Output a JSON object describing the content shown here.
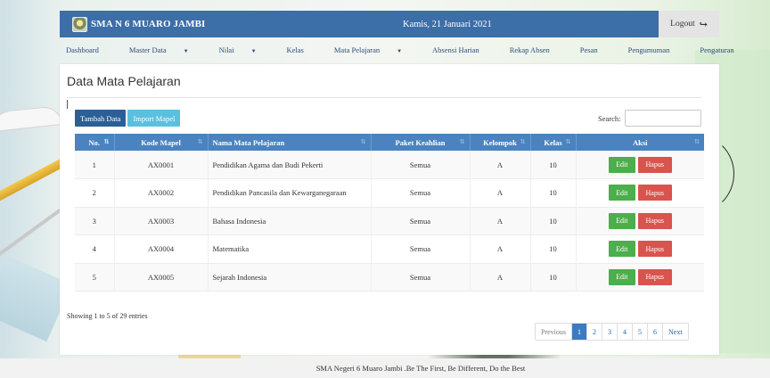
{
  "app": {
    "brand": "SMA N 6 MUARO JAMBI",
    "date": "Kamis, 21 Januari 2021",
    "logout_label": "Logout"
  },
  "menu": [
    {
      "label": "Dashboard",
      "has_caret": false
    },
    {
      "label": "Master Data",
      "has_caret": true
    },
    {
      "label": "Nilai",
      "has_caret": true
    },
    {
      "label": "Kelas",
      "has_caret": false
    },
    {
      "label": "Mata Pelajaran",
      "has_caret": true
    },
    {
      "label": "Absensi Harian",
      "has_caret": false
    },
    {
      "label": "Rekap Absen",
      "has_caret": false
    },
    {
      "label": "Pesan",
      "has_caret": false
    },
    {
      "label": "Pengumuman",
      "has_caret": false
    },
    {
      "label": "Pengaturan",
      "has_caret": false
    }
  ],
  "page": {
    "title": "Data Mata Pelajaran",
    "add_button": "Tambah Data",
    "import_button": "Import Mapel",
    "search_label": "Search:",
    "search_value": ""
  },
  "table": {
    "columns": [
      "No.",
      "Kode Mapel",
      "Nama Mata Pelajaran",
      "Paket Keahlian",
      "Kelompok",
      "Kelas",
      "Aksi"
    ],
    "rows": [
      {
        "no": "1",
        "kode": "AX0001",
        "nama": "Pendidikan Agama dan Budi Pekerti",
        "paket": "Semua",
        "kelompok": "A",
        "kelas": "10"
      },
      {
        "no": "2",
        "kode": "AX0002",
        "nama": "Pendidikan Pancasila dan Kewarganegaraan",
        "paket": "Semua",
        "kelompok": "A",
        "kelas": "10"
      },
      {
        "no": "3",
        "kode": "AX0003",
        "nama": "Bahasa Indonesia",
        "paket": "Semua",
        "kelompok": "A",
        "kelas": "10"
      },
      {
        "no": "4",
        "kode": "AX0004",
        "nama": "Matematika",
        "paket": "Semua",
        "kelompok": "A",
        "kelas": "10"
      },
      {
        "no": "5",
        "kode": "AX0005",
        "nama": "Sejarah Indonesia",
        "paket": "Semua",
        "kelompok": "A",
        "kelas": "10"
      }
    ],
    "edit_label": "Edit",
    "delete_label": "Hapus"
  },
  "info": {
    "entries": "Showing 1 to 5 of 29 entries"
  },
  "pagination": {
    "previous": "Previous",
    "pages": [
      "1",
      "2",
      "3",
      "4",
      "5",
      "6"
    ],
    "active": "1",
    "next": "Next"
  },
  "footer": {
    "text": "SMA Negeri 6 Muaro Jambi .Be The First, Be Different, Do the Best"
  },
  "colors": {
    "navbar": "#3c6ea8",
    "table_header": "#4a83bf",
    "edit": "#4cae4c",
    "delete": "#d9534f",
    "import": "#5bc0de"
  }
}
